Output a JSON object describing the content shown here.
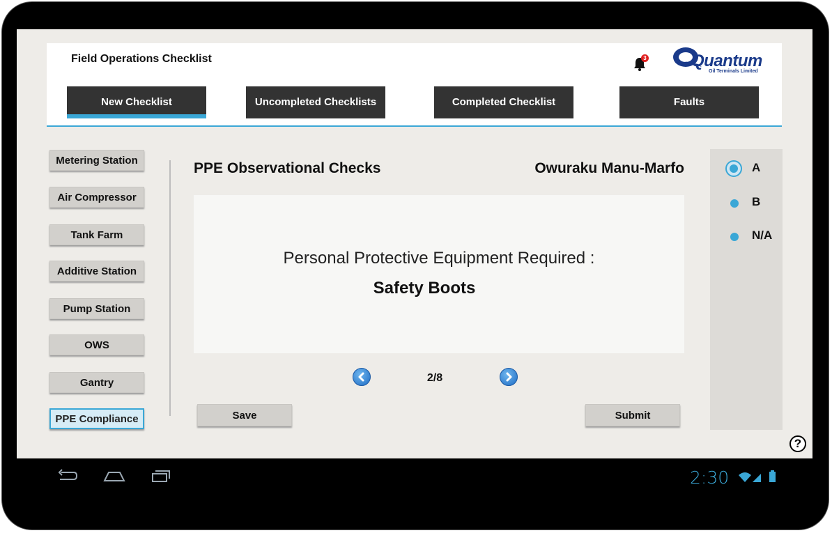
{
  "app": {
    "title": "Field Operations Checklist",
    "notification_count": "3",
    "logo_text": "Quantum",
    "logo_subtitle": "Oil Terminals Limited"
  },
  "tabs": [
    {
      "label": "New Checklist",
      "active": true
    },
    {
      "label": "Uncompleted Checklists",
      "active": false
    },
    {
      "label": "Completed Checklist",
      "active": false
    },
    {
      "label": "Faults",
      "active": false
    }
  ],
  "sidebar": {
    "items": [
      {
        "label": "Metering Station"
      },
      {
        "label": "Air Compressor"
      },
      {
        "label": "Tank Farm"
      },
      {
        "label": "Additive Station"
      },
      {
        "label": "Pump Station"
      },
      {
        "label": "OWS"
      },
      {
        "label": "Gantry"
      },
      {
        "label": "PPE Compliance",
        "active": true
      }
    ]
  },
  "main": {
    "heading": "PPE Observational Checks",
    "user_name": "Owuraku Manu-Marfo",
    "card_label": "Personal Protective Equipment Required :",
    "card_value": "Safety Boots",
    "pager": "2/8",
    "save_label": "Save",
    "submit_label": "Submit"
  },
  "options": {
    "items": [
      {
        "label": "A",
        "selected": true
      },
      {
        "label": "B",
        "selected": false
      },
      {
        "label": "N/A",
        "selected": false
      }
    ]
  },
  "help_label": "?",
  "system": {
    "time": "2:30"
  },
  "colors": {
    "accent": "#3aa7d6",
    "tab_bg": "#333333",
    "screen_bg": "#eeece8"
  }
}
